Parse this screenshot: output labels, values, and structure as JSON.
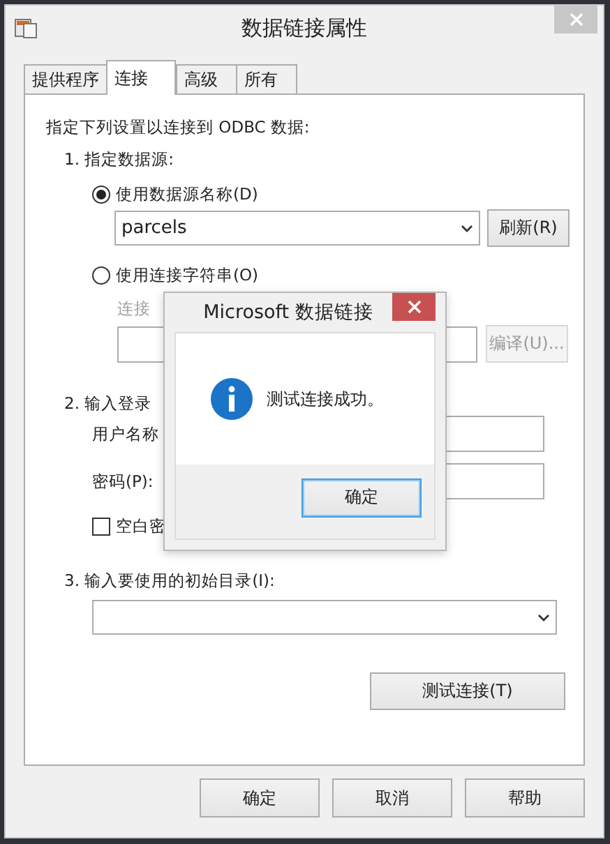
{
  "window": {
    "title": "数据链接属性"
  },
  "tabs": [
    {
      "label": "提供程序",
      "selected": false
    },
    {
      "label": "连接",
      "selected": true
    },
    {
      "label": "高级",
      "selected": false
    },
    {
      "label": "所有",
      "selected": false
    }
  ],
  "connection": {
    "intro": "指定下列设置以连接到 ODBC 数据:",
    "step1": {
      "heading": "1. 指定数据源:",
      "options": [
        {
          "label": "使用数据源名称(D)",
          "selected": true
        },
        {
          "label": "使用连接字符串(O)",
          "selected": false
        }
      ],
      "data_source": "parcels",
      "refresh_button": "刷新(R)",
      "connection_string_label": "连接",
      "compile_button": "编译(U)...",
      "compile_disabled": true
    },
    "step2": {
      "heading": "2. 输入登录",
      "username_label": "用户名称",
      "password_label": "密码(P):",
      "blank_password": {
        "label": "空白密",
        "checked": false
      }
    },
    "step3": {
      "heading": "3. 输入要使用的初始目录(I):"
    },
    "test_button": "测试连接(T)"
  },
  "buttons": [
    "确定",
    "取消",
    "帮助"
  ],
  "message_box": {
    "title": "Microsoft 数据链接",
    "message": "测试连接成功。",
    "ok_button": "确定"
  }
}
